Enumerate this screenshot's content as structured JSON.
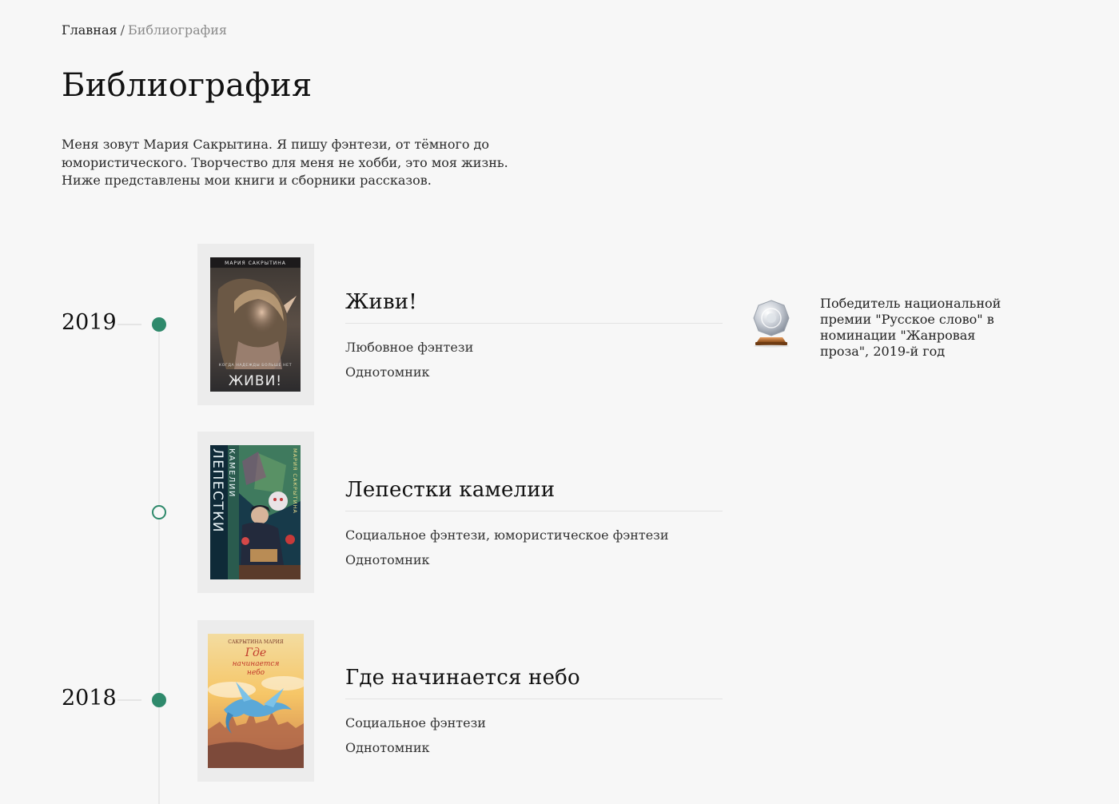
{
  "breadcrumb": {
    "home": "Главная",
    "separator": "/",
    "current": "Библиография"
  },
  "page": {
    "title": "Библиография",
    "intro": "Меня зовут Мария Сакрытина. Я пишу фэнтези, от тёмного до юмористического. Творчество для меня не хобби, это моя жизнь. Ниже представлены мои книги и сборники рассказов."
  },
  "colors": {
    "accent": "#2f8a6c",
    "background": "#f7f7f7"
  },
  "books": [
    {
      "year": "2019",
      "title": "Живи!",
      "genre": "Любовное фэнтези",
      "format": "Однотомник",
      "cover": {
        "author": "МАРИЯ САКРЫТИНА",
        "tagline": "КОГДА НАДЕЖДЫ БОЛЬШЕ НЕТ",
        "title": "ЖИВИ!"
      }
    },
    {
      "year": "",
      "title": "Лепестки камелии",
      "genre": "Социальное фэнтези, юмористическое фэнтези",
      "format": "Однотомник",
      "cover": {
        "title_vertical": "ЛЕПЕСТКИ",
        "subtitle_vertical": "КАМЕЛИИ",
        "author_vertical": "МАРИЯ САКРЫТИНА"
      }
    },
    {
      "year": "2018",
      "title": "Где начинается небо",
      "genre": "Социальное фэнтези",
      "format": "Однотомник",
      "cover": {
        "author": "САКРЫТИНА МАРИЯ",
        "title_line1": "Где",
        "title_line2": "начинается",
        "title_line3": "небо"
      }
    }
  ],
  "award": {
    "icon": "crystal-award-icon",
    "text": "Победитель национальной премии \"Русское слово\" в номинации \"Жанровая проза\", 2019-й год"
  }
}
